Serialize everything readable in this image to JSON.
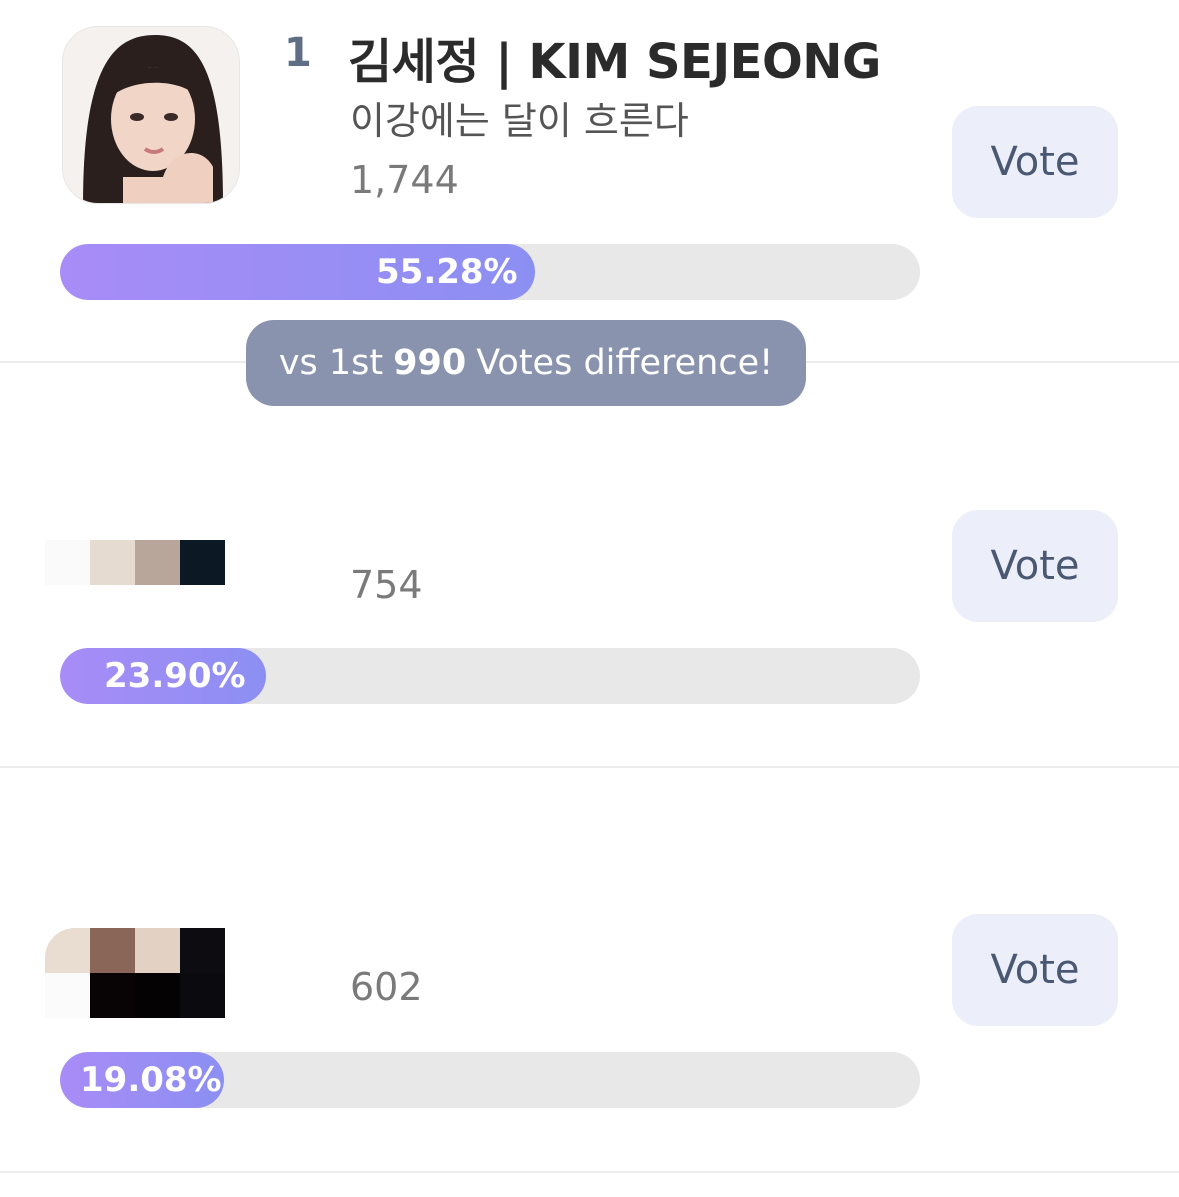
{
  "entries": [
    {
      "rank": "1",
      "name": "김세정 | KIM SEJEONG",
      "song": "이강에는 달이 흐른다",
      "votes": "1,744",
      "percent_label": "55.28%",
      "percent": 55.28,
      "vote_label": "Vote"
    },
    {
      "votes": "754",
      "percent_label": "23.90%",
      "percent": 23.9,
      "vote_label": "Vote"
    },
    {
      "votes": "602",
      "percent_label": "19.08%",
      "percent": 19.08,
      "vote_label": "Vote"
    }
  ],
  "difference_banner": {
    "prefix": "vs 1st",
    "value": "990",
    "suffix": "Votes difference!"
  },
  "colors": {
    "bar_fill_start": "#a88cf7",
    "bar_fill_end": "#8c8ff2",
    "bar_track": "#e8e8e8",
    "vote_button_bg": "#eceef9",
    "vote_button_text": "#4a5872",
    "banner_bg": "#8a93ad",
    "rank_text": "#5f6e85"
  }
}
